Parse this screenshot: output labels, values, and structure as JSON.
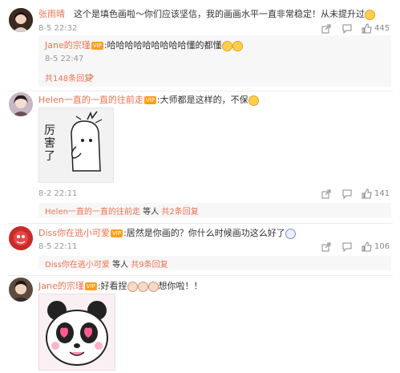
{
  "comments": [
    {
      "name": "张雨晴",
      "text": "这个是填色画啦～你们应该坚信，我的画画水平一直非常稳定！从未提升过",
      "time": "8-5 22:32",
      "likes": "445",
      "reply": {
        "name": "Jane的宗瑾",
        "text": "哈哈哈哈哈哈哈哈哈懂的都懂",
        "time": "8-5 22:47"
      },
      "more_replies": "共148条回复"
    },
    {
      "name": "Helen一直的一直的往前走",
      "text": "大师都是这样的，不保",
      "sticker_text": "厉害了",
      "time": "8-2 22:11",
      "likes": "141",
      "sub_name": "Helen一直的一直的往前走",
      "sub_suffix": "等人",
      "sub_count": "共2条回复"
    },
    {
      "name": "Diss你在逃小可爱",
      "text": "居然是你画的？你什么时候画功这么好了",
      "time": "8-5 22:11",
      "likes": "106",
      "sub_name": "Diss你在逃小可爱",
      "sub_suffix": "等人",
      "sub_count": "共9条回复"
    },
    {
      "name": "Jane的宗瑾",
      "text": "好看捏",
      "text2": "想你啦！！"
    }
  ],
  "colors": {
    "name": "#eb7350",
    "highlight": "#e53333",
    "meta": "#999999"
  }
}
